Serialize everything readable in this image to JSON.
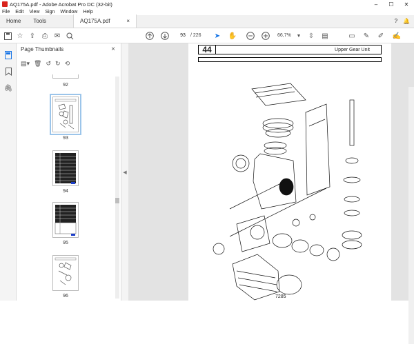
{
  "window": {
    "title": "AQ175A.pdf - Adobe Acrobat Pro DC (32-bit)",
    "controls": [
      "–",
      "☐",
      "✕"
    ]
  },
  "menu": [
    "File",
    "Edit",
    "View",
    "Sign",
    "Window",
    "Help"
  ],
  "tabs": {
    "home": "Home",
    "tools": "Tools",
    "doc": "AQ175A.pdf",
    "doc_close": "×"
  },
  "toolbar": {
    "page_current": "93",
    "page_total": "/ 226",
    "zoom": "66,7%"
  },
  "panel": {
    "title": "Page Thumbnails",
    "close": "×"
  },
  "thumbnails": [
    {
      "label": "92"
    },
    {
      "label": "93"
    },
    {
      "label": "94"
    },
    {
      "label": "95"
    },
    {
      "label": "96"
    }
  ],
  "page": {
    "section_number": "44",
    "section_title": "Upper Gear Unit",
    "figure_number": "7285"
  },
  "colors": {
    "accent": "#1473e6",
    "selection": "#9cc5ea",
    "brand": "#d9231c"
  }
}
